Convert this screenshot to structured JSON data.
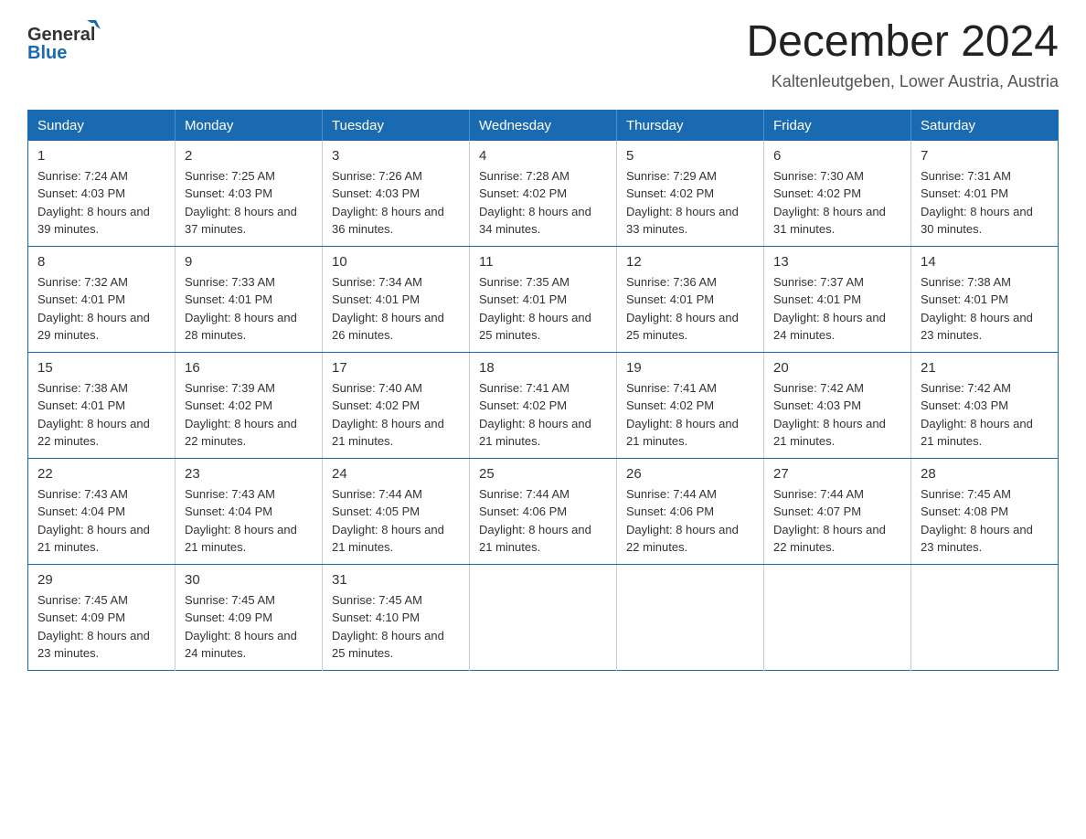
{
  "header": {
    "logo_general": "General",
    "logo_blue": "Blue",
    "month_title": "December 2024",
    "location": "Kaltenleutgeben, Lower Austria, Austria"
  },
  "weekdays": [
    "Sunday",
    "Monday",
    "Tuesday",
    "Wednesday",
    "Thursday",
    "Friday",
    "Saturday"
  ],
  "weeks": [
    [
      {
        "day": "1",
        "sunrise": "7:24 AM",
        "sunset": "4:03 PM",
        "daylight": "8 hours and 39 minutes."
      },
      {
        "day": "2",
        "sunrise": "7:25 AM",
        "sunset": "4:03 PM",
        "daylight": "8 hours and 37 minutes."
      },
      {
        "day": "3",
        "sunrise": "7:26 AM",
        "sunset": "4:03 PM",
        "daylight": "8 hours and 36 minutes."
      },
      {
        "day": "4",
        "sunrise": "7:28 AM",
        "sunset": "4:02 PM",
        "daylight": "8 hours and 34 minutes."
      },
      {
        "day": "5",
        "sunrise": "7:29 AM",
        "sunset": "4:02 PM",
        "daylight": "8 hours and 33 minutes."
      },
      {
        "day": "6",
        "sunrise": "7:30 AM",
        "sunset": "4:02 PM",
        "daylight": "8 hours and 31 minutes."
      },
      {
        "day": "7",
        "sunrise": "7:31 AM",
        "sunset": "4:01 PM",
        "daylight": "8 hours and 30 minutes."
      }
    ],
    [
      {
        "day": "8",
        "sunrise": "7:32 AM",
        "sunset": "4:01 PM",
        "daylight": "8 hours and 29 minutes."
      },
      {
        "day": "9",
        "sunrise": "7:33 AM",
        "sunset": "4:01 PM",
        "daylight": "8 hours and 28 minutes."
      },
      {
        "day": "10",
        "sunrise": "7:34 AM",
        "sunset": "4:01 PM",
        "daylight": "8 hours and 26 minutes."
      },
      {
        "day": "11",
        "sunrise": "7:35 AM",
        "sunset": "4:01 PM",
        "daylight": "8 hours and 25 minutes."
      },
      {
        "day": "12",
        "sunrise": "7:36 AM",
        "sunset": "4:01 PM",
        "daylight": "8 hours and 25 minutes."
      },
      {
        "day": "13",
        "sunrise": "7:37 AM",
        "sunset": "4:01 PM",
        "daylight": "8 hours and 24 minutes."
      },
      {
        "day": "14",
        "sunrise": "7:38 AM",
        "sunset": "4:01 PM",
        "daylight": "8 hours and 23 minutes."
      }
    ],
    [
      {
        "day": "15",
        "sunrise": "7:38 AM",
        "sunset": "4:01 PM",
        "daylight": "8 hours and 22 minutes."
      },
      {
        "day": "16",
        "sunrise": "7:39 AM",
        "sunset": "4:02 PM",
        "daylight": "8 hours and 22 minutes."
      },
      {
        "day": "17",
        "sunrise": "7:40 AM",
        "sunset": "4:02 PM",
        "daylight": "8 hours and 21 minutes."
      },
      {
        "day": "18",
        "sunrise": "7:41 AM",
        "sunset": "4:02 PM",
        "daylight": "8 hours and 21 minutes."
      },
      {
        "day": "19",
        "sunrise": "7:41 AM",
        "sunset": "4:02 PM",
        "daylight": "8 hours and 21 minutes."
      },
      {
        "day": "20",
        "sunrise": "7:42 AM",
        "sunset": "4:03 PM",
        "daylight": "8 hours and 21 minutes."
      },
      {
        "day": "21",
        "sunrise": "7:42 AM",
        "sunset": "4:03 PM",
        "daylight": "8 hours and 21 minutes."
      }
    ],
    [
      {
        "day": "22",
        "sunrise": "7:43 AM",
        "sunset": "4:04 PM",
        "daylight": "8 hours and 21 minutes."
      },
      {
        "day": "23",
        "sunrise": "7:43 AM",
        "sunset": "4:04 PM",
        "daylight": "8 hours and 21 minutes."
      },
      {
        "day": "24",
        "sunrise": "7:44 AM",
        "sunset": "4:05 PM",
        "daylight": "8 hours and 21 minutes."
      },
      {
        "day": "25",
        "sunrise": "7:44 AM",
        "sunset": "4:06 PM",
        "daylight": "8 hours and 21 minutes."
      },
      {
        "day": "26",
        "sunrise": "7:44 AM",
        "sunset": "4:06 PM",
        "daylight": "8 hours and 22 minutes."
      },
      {
        "day": "27",
        "sunrise": "7:44 AM",
        "sunset": "4:07 PM",
        "daylight": "8 hours and 22 minutes."
      },
      {
        "day": "28",
        "sunrise": "7:45 AM",
        "sunset": "4:08 PM",
        "daylight": "8 hours and 23 minutes."
      }
    ],
    [
      {
        "day": "29",
        "sunrise": "7:45 AM",
        "sunset": "4:09 PM",
        "daylight": "8 hours and 23 minutes."
      },
      {
        "day": "30",
        "sunrise": "7:45 AM",
        "sunset": "4:09 PM",
        "daylight": "8 hours and 24 minutes."
      },
      {
        "day": "31",
        "sunrise": "7:45 AM",
        "sunset": "4:10 PM",
        "daylight": "8 hours and 25 minutes."
      },
      null,
      null,
      null,
      null
    ]
  ]
}
